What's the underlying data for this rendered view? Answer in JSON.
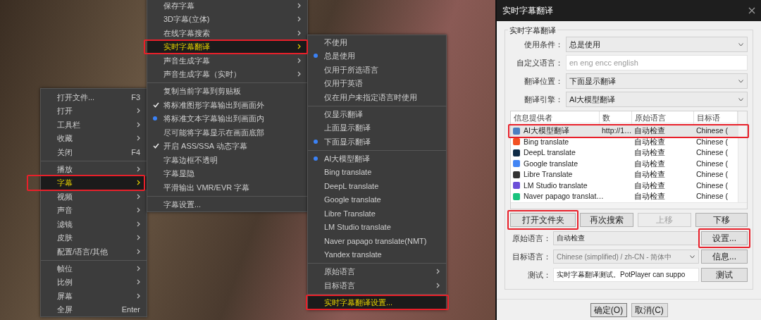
{
  "menus": [
    {
      "sections": [
        [
          {
            "label": "打开文件...",
            "shortcut": "F3",
            "submenu": false,
            "selected": false
          },
          {
            "label": "打开",
            "submenu": true,
            "selected": false
          },
          {
            "label": "工具栏",
            "submenu": true,
            "selected": false
          },
          {
            "label": "收藏",
            "submenu": true,
            "selected": false
          },
          {
            "label": "关闭",
            "shortcut": "F4",
            "submenu": false,
            "selected": false
          }
        ],
        [
          {
            "label": "播放",
            "submenu": true,
            "selected": false
          },
          {
            "label": "字幕",
            "submenu": true,
            "selected": true,
            "framed": true
          },
          {
            "label": "视频",
            "submenu": true,
            "selected": false
          },
          {
            "label": "声音",
            "submenu": true,
            "selected": false
          },
          {
            "label": "滤镜",
            "submenu": true,
            "selected": false
          },
          {
            "label": "皮肤",
            "submenu": true,
            "selected": false
          },
          {
            "label": "配置/语言/其他",
            "submenu": true,
            "selected": false
          }
        ],
        [
          {
            "label": "帧位",
            "submenu": true,
            "selected": false
          },
          {
            "label": "比例",
            "submenu": true,
            "selected": false
          },
          {
            "label": "屏幕",
            "submenu": true,
            "selected": false
          },
          {
            "label": "全屏",
            "shortcut": "Enter",
            "submenu": false,
            "selected": false
          }
        ]
      ]
    },
    {
      "sections": [
        [
          {
            "label": "保存字幕",
            "submenu": true,
            "selected": false
          },
          {
            "label": "3D字幕(立体)",
            "submenu": true,
            "selected": false
          },
          {
            "label": "在线字幕搜索",
            "submenu": true,
            "selected": false
          },
          {
            "label": "实时字幕翻译",
            "submenu": true,
            "selected": true,
            "framed": true
          },
          {
            "label": "声音生成字幕",
            "submenu": true,
            "selected": false
          },
          {
            "label": "声音生成字幕（实时）",
            "submenu": true,
            "selected": false
          }
        ],
        [
          {
            "label": "复制当前字幕到剪贴板",
            "checked": false,
            "submenu": false,
            "selected": false
          },
          {
            "label": "将标准图形字幕输出到画面外",
            "kind": "check",
            "checked": true,
            "submenu": false,
            "selected": false
          },
          {
            "label": "将标准文本字幕输出到画面内",
            "kind": "radio",
            "checked": true,
            "submenu": false,
            "selected": false
          },
          {
            "label": "尽可能将字幕显示在画面底部",
            "checked": false,
            "submenu": false,
            "selected": false
          },
          {
            "label": "开启 ASS/SSA 动态字幕",
            "kind": "check",
            "checked": true,
            "submenu": false,
            "selected": false
          },
          {
            "label": "字幕边框不透明",
            "checked": false,
            "submenu": false,
            "selected": false
          },
          {
            "label": "字幕显隐",
            "checked": false,
            "submenu": false,
            "selected": false
          },
          {
            "label": "平滑输出 VMR/EVR 字幕",
            "checked": false,
            "submenu": false,
            "selected": false
          }
        ],
        [
          {
            "label": "字幕设置...",
            "submenu": false,
            "selected": false
          }
        ]
      ]
    },
    {
      "sections": [
        [
          {
            "label": "不使用",
            "checked": false,
            "submenu": false,
            "selected": false
          },
          {
            "label": "总是使用",
            "kind": "radio",
            "checked": true,
            "submenu": false,
            "selected": false
          },
          {
            "label": "仅用于所选语言",
            "checked": false,
            "submenu": false,
            "selected": false
          },
          {
            "label": "仅用于英语",
            "checked": false,
            "submenu": false,
            "selected": false
          },
          {
            "label": "仅在用户未指定语言时使用",
            "checked": false,
            "submenu": false,
            "selected": false
          }
        ],
        [
          {
            "label": "仅显示翻译",
            "checked": false,
            "submenu": false,
            "selected": false
          },
          {
            "label": "上面显示翻译",
            "checked": false,
            "submenu": false,
            "selected": false
          },
          {
            "label": "下面显示翻译",
            "kind": "radio",
            "checked": true,
            "submenu": false,
            "selected": false
          }
        ],
        [
          {
            "label": "AI大模型翻译",
            "kind": "radio",
            "checked": true,
            "submenu": false,
            "selected": false
          },
          {
            "label": "Bing translate",
            "checked": false,
            "submenu": false,
            "selected": false
          },
          {
            "label": "DeepL translate",
            "checked": false,
            "submenu": false,
            "selected": false
          },
          {
            "label": "Google translate",
            "checked": false,
            "submenu": false,
            "selected": false
          },
          {
            "label": "Libre Translate",
            "checked": false,
            "submenu": false,
            "selected": false
          },
          {
            "label": "LM Studio translate",
            "checked": false,
            "submenu": false,
            "selected": false
          },
          {
            "label": "Naver papago translate(NMT)",
            "checked": false,
            "submenu": false,
            "selected": false
          },
          {
            "label": "Yandex translate",
            "checked": false,
            "submenu": false,
            "selected": false
          }
        ],
        [
          {
            "label": "原始语言",
            "submenu": true,
            "selected": false
          },
          {
            "label": "目标语言",
            "submenu": true,
            "selected": false
          }
        ],
        [
          {
            "label": "实时字幕翻译设置...",
            "submenu": false,
            "selected": true,
            "framed": true
          }
        ]
      ]
    }
  ],
  "dialog": {
    "title": "实时字幕翻译",
    "group_title": "实时字幕翻译",
    "fields": [
      {
        "label": "使用条件：",
        "kind": "select",
        "value": "总是使用"
      },
      {
        "label": "自定义语言：",
        "kind": "input",
        "placeholder": "en eng encc english"
      },
      {
        "label": "翻译位置：",
        "kind": "select",
        "value": "下面显示翻译"
      },
      {
        "label": "翻译引擎：",
        "kind": "select",
        "value": "AI大模型翻译"
      }
    ],
    "providers": {
      "columns": [
        "信息提供者",
        "数",
        "原始语言",
        "目标语"
      ],
      "rows": [
        {
          "name": "AI大模型翻译",
          "address": "http://1…",
          "source": "自动检查",
          "target": "Chinese (",
          "color": "#4a7fc1",
          "selected": true,
          "framed": true
        },
        {
          "name": "Bing translate",
          "source": "自动检查",
          "target": "Chinese (",
          "color": "#f25022",
          "selected": false
        },
        {
          "name": "DeepL translate",
          "source": "自动检查",
          "target": "Chinese (",
          "color": "#0f2b46",
          "selected": false
        },
        {
          "name": "Google translate",
          "source": "自动检查",
          "target": "Chinese (",
          "color": "#4285f4",
          "selected": false
        },
        {
          "name": "Libre Translate",
          "source": "自动检查",
          "target": "Chinese (",
          "color": "#333333",
          "selected": false
        },
        {
          "name": "LM Studio translate",
          "source": "自动检查",
          "target": "Chinese (",
          "color": "#6b4fd8",
          "selected": false
        },
        {
          "name": "Naver papago translat…",
          "source": "自动检查",
          "target": "Chinese (",
          "color": "#19c37d",
          "selected": false
        }
      ]
    },
    "list_buttons": [
      {
        "label": "打开文件夹",
        "disabled": false,
        "framed": true
      },
      {
        "label": "再次搜索",
        "disabled": false
      },
      {
        "label": "上移",
        "disabled": true
      },
      {
        "label": "下移",
        "disabled": false
      }
    ],
    "lower_fields": [
      {
        "label": "原始语言：",
        "kind": "readonly",
        "value": "自动检查",
        "button": {
          "label": "设置...",
          "framed": true
        }
      },
      {
        "label": "目标语言：",
        "kind": "select",
        "value": "Chinese (simplified) / zh-CN - 简体中",
        "disabled": true,
        "button": {
          "label": "信息..."
        }
      },
      {
        "label": "测试：",
        "kind": "input",
        "value": "实时字幕翻译测试。PotPlayer can suppo",
        "button": {
          "label": "测试"
        }
      }
    ],
    "footer_buttons": [
      {
        "label": "确定(O)",
        "default": true
      },
      {
        "label": "取消(C)",
        "default": false
      }
    ]
  }
}
